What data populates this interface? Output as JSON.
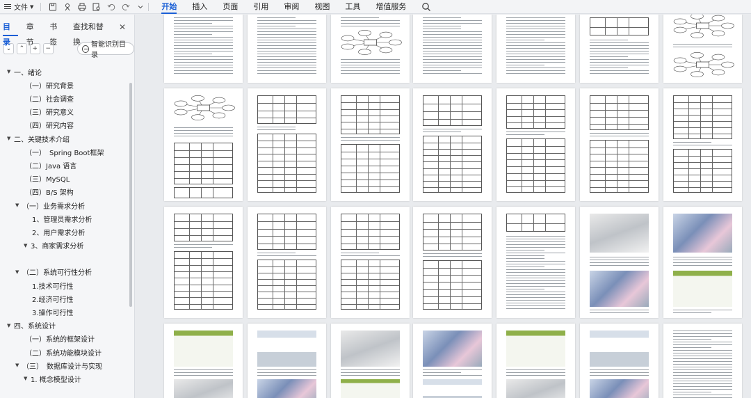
{
  "toolbar": {
    "file_label": "文件",
    "tabs": [
      {
        "label": "开始",
        "active": true
      },
      {
        "label": "插入"
      },
      {
        "label": "页面"
      },
      {
        "label": "引用"
      },
      {
        "label": "审阅"
      },
      {
        "label": "视图"
      },
      {
        "label": "工具"
      },
      {
        "label": "增值服务"
      }
    ],
    "icons": [
      "hamburger-icon",
      "save-icon",
      "share-icon",
      "print-icon",
      "print-preview-icon",
      "undo-icon",
      "redo-icon",
      "more-icon",
      "search-icon"
    ]
  },
  "nav": {
    "tabs": [
      {
        "label": "目录",
        "active": true
      },
      {
        "label": "章节"
      },
      {
        "label": "书签"
      },
      {
        "label": "查找和替换"
      }
    ],
    "close_icon": "close-icon",
    "tools": {
      "collapse": "⌄",
      "expand": "⌃",
      "add": "+",
      "remove": "−"
    },
    "smart_button": "智能识别目录",
    "toc": [
      {
        "label": "一、绪论",
        "level": 0,
        "arrow": true
      },
      {
        "label": "（一）研究背景",
        "level": 1
      },
      {
        "label": "（二）社会调查",
        "level": 1
      },
      {
        "label": "（三）研究意义",
        "level": 1
      },
      {
        "label": "（四）研究内容",
        "level": 1
      },
      {
        "label": "二、关键技术介绍",
        "level": 0,
        "arrow": true
      },
      {
        "label": "（一）　Spring Boot框架",
        "level": 1
      },
      {
        "label": "（二）Java 语言",
        "level": 1
      },
      {
        "label": "（三）MySQL",
        "level": 1
      },
      {
        "label": "（四）B/S 架构",
        "level": 1
      },
      {
        "label": "（一）业务需求分析",
        "level": 1,
        "arrow": true
      },
      {
        "label": "1、管理员需求分析",
        "level": 2
      },
      {
        "label": "2、用户需求分析",
        "level": 2
      },
      {
        "label": "3、商家需求分析",
        "level": 2,
        "arrow": true
      },
      {
        "label": "（二）系统可行性分析",
        "level": 1,
        "arrow": true,
        "gap": true
      },
      {
        "label": "1.技术可行性",
        "level": 2
      },
      {
        "label": "2.经济可行性",
        "level": 2
      },
      {
        "label": "3.操作可行性",
        "level": 2
      },
      {
        "label": "四、系统设计",
        "level": 0,
        "arrow": true
      },
      {
        "label": "（一）系统的框架设计",
        "level": 1
      },
      {
        "label": "（二）系统功能模块设计",
        "level": 1
      },
      {
        "label": "（三）　数据库设计与实现",
        "level": 1,
        "arrow": true
      },
      {
        "label": "1. 概念模型设计",
        "level": 2,
        "arrow": true
      }
    ]
  },
  "thumbnails": {
    "rows": [
      [
        "text",
        "text",
        "text-diagram",
        "text",
        "text",
        "text-table",
        "diagram"
      ],
      [
        "diagram-table",
        "table",
        "table",
        "table",
        "table",
        "table",
        "table"
      ],
      [
        "table",
        "table",
        "table",
        "table",
        "text-table",
        "screenshot",
        "screenshot"
      ],
      [
        "screenshot",
        "screenshot",
        "screenshot",
        "screenshot",
        "screenshot",
        "screenshot",
        "text"
      ]
    ]
  }
}
